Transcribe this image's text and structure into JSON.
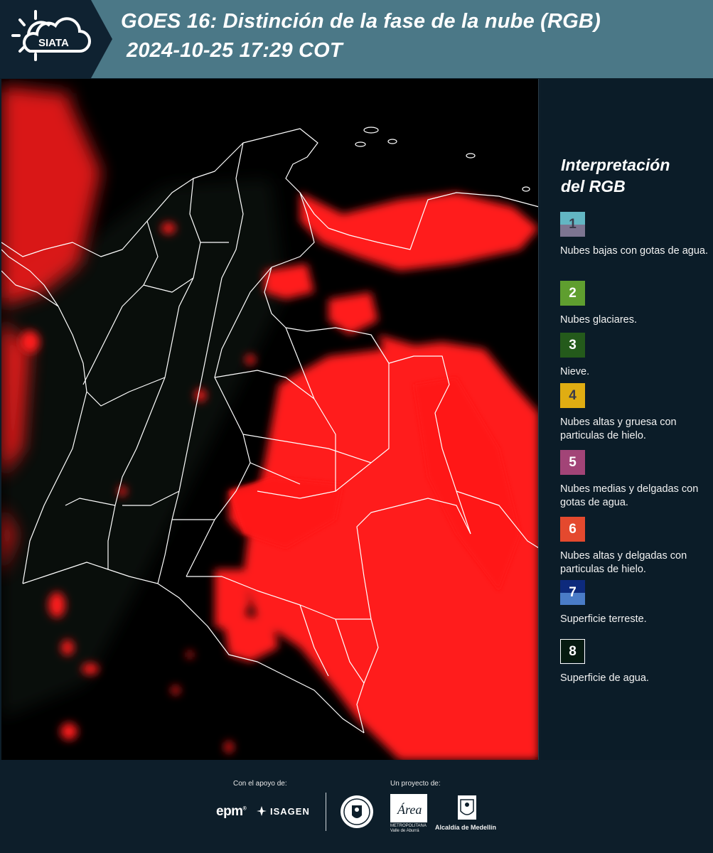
{
  "header": {
    "logo_text": "SIATA",
    "title_line1": "GOES 16: Distinción de la fase de la nube (RGB)",
    "title_line2": "2024-10-25 17:29 COT",
    "band_color": "#4b7887",
    "bg_color": "#0f2231"
  },
  "legend": {
    "title_line1": "Interpretación",
    "title_line2": "del RGB",
    "items": [
      {
        "number": "1",
        "label": "Nubes bajas con gotas de agua.",
        "color_top": "#63b6c3",
        "color_bottom": "#7d7591",
        "num_color": "#3a3a4a"
      },
      {
        "number": "2",
        "label": "Nubes glaciares.",
        "color_top": "#5f9e2f",
        "color_bottom": "#5f9e2f",
        "num_color": "#ffffff"
      },
      {
        "number": "3",
        "label": "Nieve.",
        "color_top": "#245a1b",
        "color_bottom": "#245a1b",
        "num_color": "#ffffff"
      },
      {
        "number": "4",
        "label": "Nubes altas y gruesa con particulas de hielo.",
        "color_top": "#e0ad12",
        "color_bottom": "#e0ad12",
        "num_color": "#3a3a4a"
      },
      {
        "number": "5",
        "label": "Nubes medias y delgadas con gotas de agua.",
        "color_top": "#a24477",
        "color_bottom": "#a24477",
        "num_color": "#ffffff"
      },
      {
        "number": "6",
        "label": "Nubes altas y delgadas con particulas de hielo.",
        "color_top": "#e4492e",
        "color_bottom": "#e4492e",
        "num_color": "#ffffff"
      },
      {
        "number": "7",
        "label": "Superficie terreste.",
        "color_top": "#0d2a7c",
        "color_bottom": "#4a7cc7",
        "num_color": "#ffffff"
      },
      {
        "number": "8",
        "label": "Superficie de agua.",
        "color_top": "#061a10",
        "color_bottom": "#061a10",
        "num_color": "#ffffff"
      }
    ]
  },
  "map": {
    "cloud_color": "#ff1a1a",
    "background_color": "#000000",
    "border_color": "#ffffff"
  },
  "footer": {
    "support_label": "Con el apoyo de:",
    "project_label": "Un proyecto de:",
    "sponsor1": "epm",
    "sponsor1_mark": "®",
    "sponsor2": "ISAGEN",
    "partner1_line1": "METROPOLITANA",
    "partner1_line2": "Valle de Aburrá",
    "partner1_script": "Área",
    "partner2": "Alcaldía de Medellín"
  }
}
